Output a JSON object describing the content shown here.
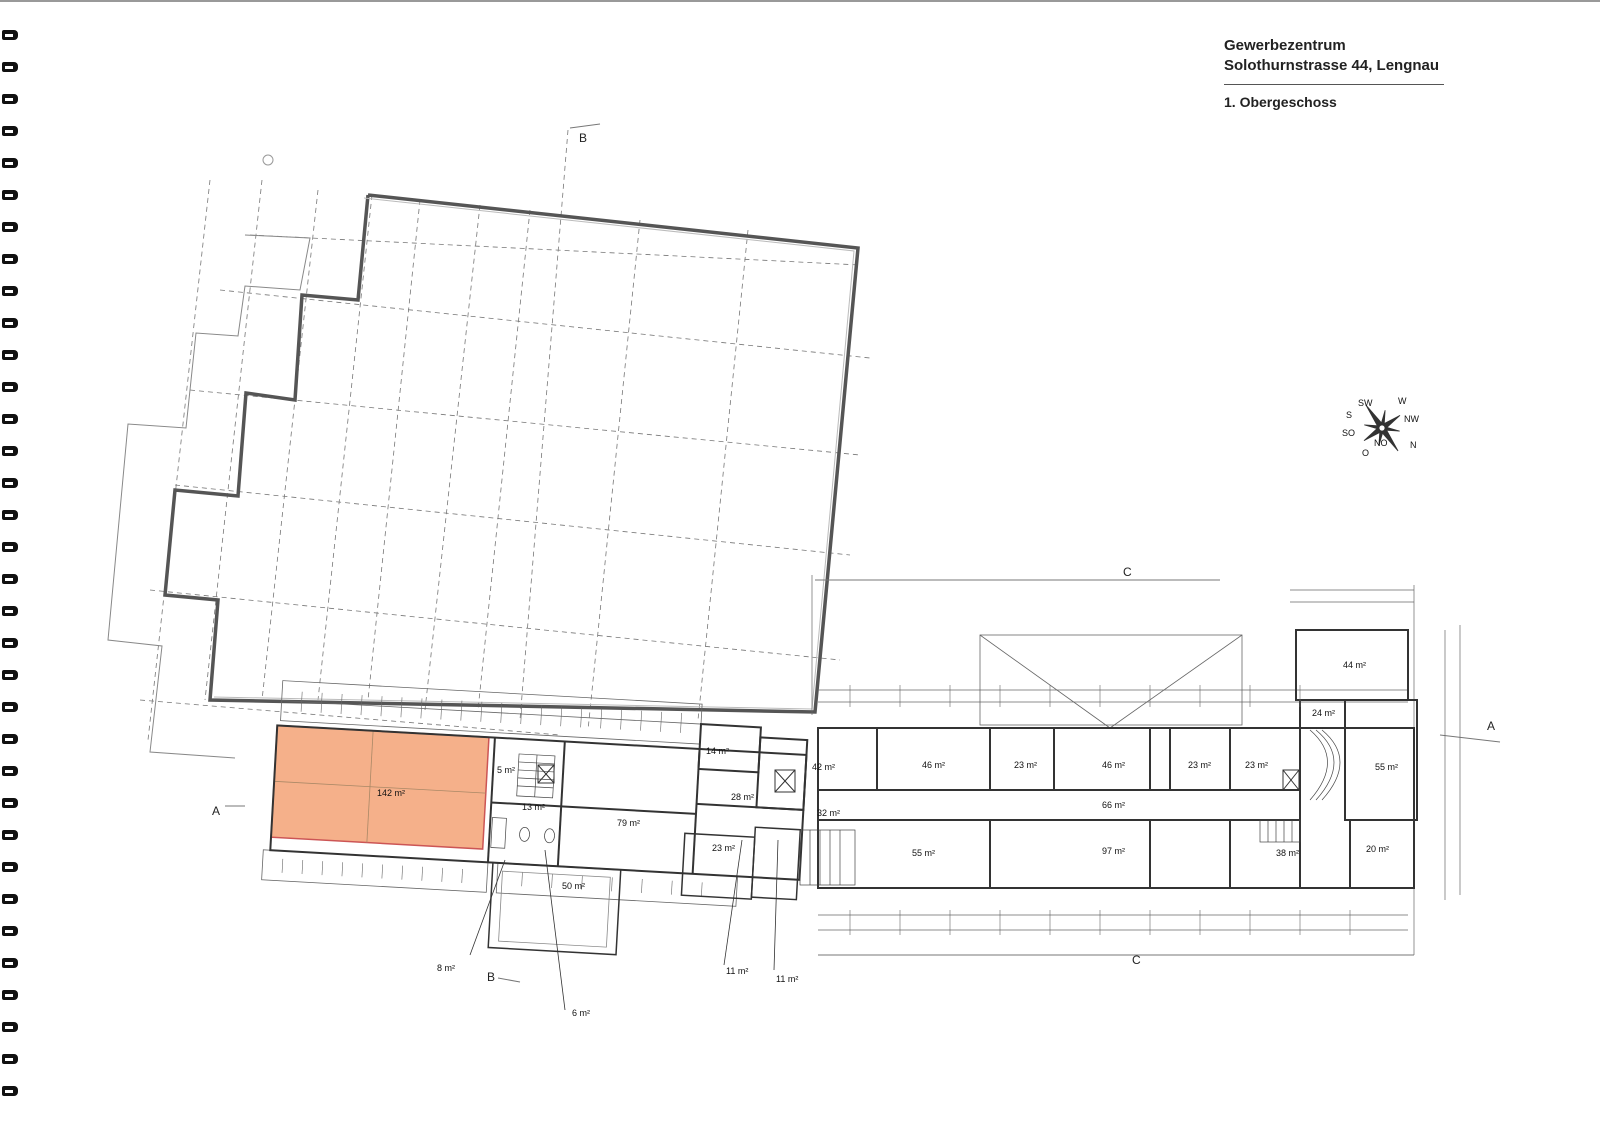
{
  "header": {
    "title_line1": "Gewerbezentrum",
    "title_line2": "Solothurnstrasse 44, Lengnau",
    "floor": "1. Obergeschoss"
  },
  "compass": {
    "labels": [
      "W",
      "SW",
      "S",
      "SO",
      "O",
      "NO",
      "N",
      "NW"
    ]
  },
  "section_marks": [
    "A",
    "A",
    "B",
    "B",
    "C",
    "C"
  ],
  "highlight_color": "#f5b08a",
  "rooms": {
    "r142": "142 m²",
    "r5": "5 m²",
    "r13": "13 m²",
    "r79": "79 m²",
    "r14": "14 m²",
    "r28": "28 m²",
    "r42": "42 m²",
    "r32": "32 m²",
    "r23a": "23 m²",
    "r50": "50 m²",
    "r46a": "46 m²",
    "r23b": "23 m²",
    "r46b": "46 m²",
    "r23c": "23 m²",
    "r23d": "23 m²",
    "r66": "66 m²",
    "r55a": "55 m²",
    "r97": "97 m²",
    "r38": "38 m²",
    "r20": "20 m²",
    "r44": "44 m²",
    "r24": "24 m²",
    "r55b": "55 m²",
    "r8": "8 m²",
    "r6": "6 m²",
    "r11a": "11 m²",
    "r11b": "11 m²"
  }
}
